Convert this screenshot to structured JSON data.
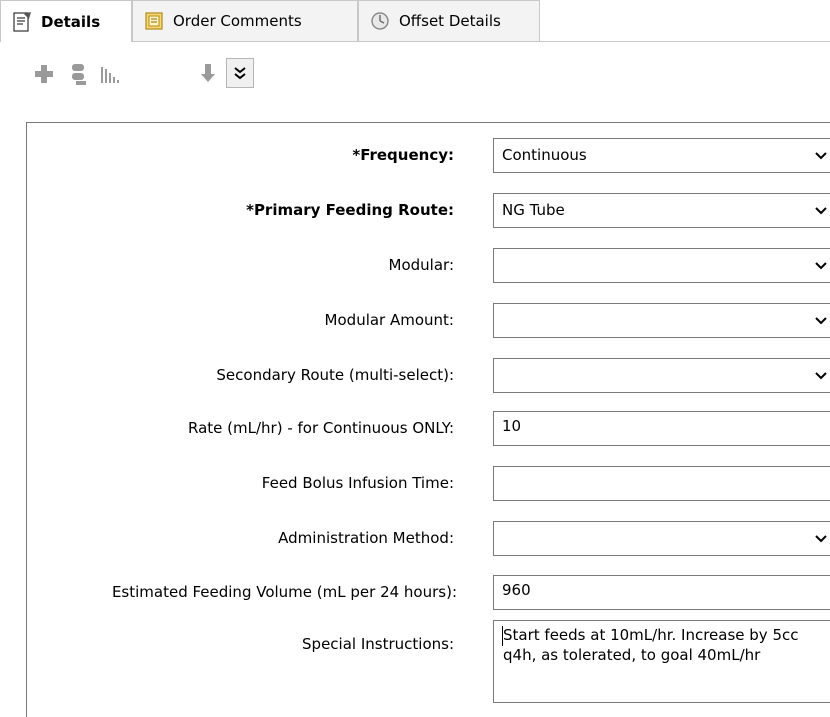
{
  "tabs": [
    {
      "label": "Details",
      "icon": "details-page-icon",
      "active": true
    },
    {
      "label": "Order Comments",
      "icon": "comments-book-icon",
      "active": false
    },
    {
      "label": "Offset Details",
      "icon": "clock-icon",
      "active": false
    }
  ],
  "toolbar": {
    "icons": [
      "add-icon",
      "unlink-icon",
      "chart-icon",
      "down-arrow-icon",
      "double-chevron-down-icon"
    ]
  },
  "form": {
    "frequency": {
      "label": "*Frequency:",
      "value": "Continuous"
    },
    "primary_feeding_route": {
      "label": "*Primary Feeding Route:",
      "value": "NG Tube"
    },
    "modular": {
      "label": "Modular:",
      "value": ""
    },
    "modular_amount": {
      "label": "Modular Amount:",
      "value": ""
    },
    "secondary_route": {
      "label": "Secondary Route (multi-select):",
      "value": ""
    },
    "rate": {
      "label": "Rate (mL/hr) - for Continuous ONLY:",
      "value": "10"
    },
    "feed_bolus_infusion_time": {
      "label": "Feed Bolus Infusion Time:",
      "value": ""
    },
    "administration_method": {
      "label": "Administration Method:",
      "value": ""
    },
    "estimated_feeding_volume": {
      "label": "Estimated Feeding Volume (mL per 24 hours):",
      "value": "960"
    },
    "special_instructions": {
      "label": "Special Instructions:",
      "value": "Start feeds at 10mL/hr. Increase by 5cc q4h, as tolerated, to goal 40mL/hr"
    }
  },
  "colors": {
    "border": "#7a7a7a",
    "tab_inactive_bg": "#f3f3f3",
    "disabled_icon": "#9a9a9a"
  }
}
